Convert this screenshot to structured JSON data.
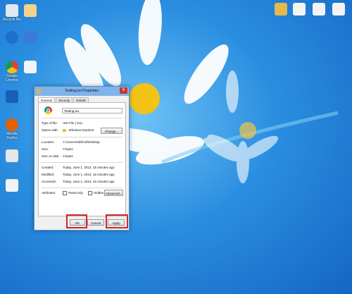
{
  "desktop": {
    "left_icons": [
      {
        "name": "Recycle Bin",
        "icon": "recycle-bin-icon",
        "color": "#dfe8ef"
      },
      {
        "name": "",
        "icon": "app-icon",
        "color": "#f1d38a"
      },
      {
        "name": "",
        "icon": "bluetooth-icon",
        "color": "#1f6fcf"
      },
      {
        "name": "",
        "icon": "app-icon",
        "color": "#3a7bd5"
      },
      {
        "name": "Google Chrome",
        "icon": "chrome-icon",
        "color": "#e64a3b"
      },
      {
        "name": "",
        "icon": "document-icon",
        "color": "#f3f3f3"
      },
      {
        "name": "",
        "icon": "app-icon",
        "color": "#1a5fb4"
      },
      {
        "name": "Mozilla Firefox",
        "icon": "firefox-icon",
        "color": "#e66000"
      },
      {
        "name": "",
        "icon": "app-icon",
        "color": "#e7e7e7"
      },
      {
        "name": "",
        "icon": "document-icon",
        "color": "#f3f3f3"
      }
    ],
    "right_icons": [
      {
        "name": "",
        "icon": "folder-icon",
        "color": "#e5b94c"
      },
      {
        "name": "",
        "icon": "document-icon",
        "color": "#f3f3f3"
      },
      {
        "name": "",
        "icon": "document-icon",
        "color": "#f3f3f3"
      },
      {
        "name": "",
        "icon": "document-icon",
        "color": "#f3f3f3"
      }
    ]
  },
  "dialog": {
    "title": "Testing.iso Properties",
    "close": "✕",
    "tabs": [
      "General",
      "Security",
      "Details"
    ],
    "file_name": "Testing.iso",
    "type_label": "Type of file:",
    "type_value": "ISO File (.iso)",
    "opens_label": "Opens with:",
    "opens_value": "Windows Explorer",
    "change_button": "Change...",
    "location_label": "Location:",
    "location_value": "C:\\Users\\rabil\\AD\\Desktop",
    "size_label": "Size:",
    "size_value": "0 bytes",
    "size_disk_label": "Size on disk:",
    "size_disk_value": "0 bytes",
    "created_label": "Created:",
    "created_value": "Today, June 1, 2013, 15 minutes ago",
    "modified_label": "Modified:",
    "modified_value": "Today, June 1, 2013, 15 minutes ago",
    "accessed_label": "Accessed:",
    "accessed_value": "Today, June 1, 2013, 15 minutes ago",
    "attributes_label": "Attributes:",
    "readonly_label": "Read-only",
    "hidden_label": "Hidden",
    "advanced_button": "Advanced...",
    "ok_button": "OK",
    "cancel_button": "Cancel",
    "apply_button": "Apply"
  },
  "colors": {
    "highlight": "#d8232a",
    "titlebar": "#7fb4ea"
  }
}
